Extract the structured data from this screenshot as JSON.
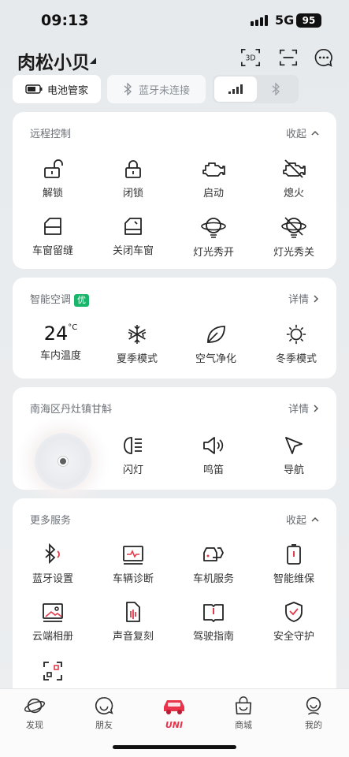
{
  "status": {
    "time": "09:13",
    "network": "5G",
    "battery": "95"
  },
  "header": {
    "car_name": "肉松小贝",
    "view_3d": "3D"
  },
  "chips": {
    "battery_manager": "电池管家",
    "bluetooth_status": "蓝牙未连接"
  },
  "remote_control": {
    "title": "远程控制",
    "toggle": "收起",
    "items": [
      {
        "label": "解锁",
        "icon": "unlock-icon"
      },
      {
        "label": "闭锁",
        "icon": "lock-icon"
      },
      {
        "label": "启动",
        "icon": "engine-start-icon"
      },
      {
        "label": "熄火",
        "icon": "engine-off-icon"
      },
      {
        "label": "车窗留缝",
        "icon": "window-vent-icon"
      },
      {
        "label": "关闭车窗",
        "icon": "window-close-icon"
      },
      {
        "label": "灯光秀开",
        "icon": "lightshow-on-icon"
      },
      {
        "label": "灯光秀关",
        "icon": "lightshow-off-icon"
      }
    ]
  },
  "climate": {
    "title": "智能空调",
    "badge": "优",
    "details": "详情",
    "temperature": "24",
    "temperature_unit": "°C",
    "items": [
      {
        "label": "车内温度"
      },
      {
        "label": "夏季模式",
        "icon": "snowflake-icon"
      },
      {
        "label": "空气净化",
        "icon": "leaf-icon"
      },
      {
        "label": "冬季模式",
        "icon": "sun-icon"
      }
    ]
  },
  "location": {
    "title": "南海区丹灶镇甘斛",
    "details": "详情",
    "items": [
      {
        "label": "闪灯",
        "icon": "headlight-icon"
      },
      {
        "label": "鸣笛",
        "icon": "horn-icon"
      },
      {
        "label": "导航",
        "icon": "navigation-icon"
      }
    ]
  },
  "more_services": {
    "title": "更多服务",
    "toggle": "收起",
    "items": [
      {
        "label": "蓝牙设置",
        "icon": "bluetooth-settings-icon"
      },
      {
        "label": "车辆诊断",
        "icon": "diagnosis-icon"
      },
      {
        "label": "车机服务",
        "icon": "car-service-icon"
      },
      {
        "label": "智能维保",
        "icon": "maintenance-icon"
      },
      {
        "label": "云端相册",
        "icon": "album-icon"
      },
      {
        "label": "声音复刻",
        "icon": "voice-clone-icon"
      },
      {
        "label": "驾驶指南",
        "icon": "guide-book-icon"
      },
      {
        "label": "安全守护",
        "icon": "shield-icon"
      }
    ]
  },
  "tabbar": {
    "items": [
      {
        "label": "发现",
        "icon": "planet-icon"
      },
      {
        "label": "朋友",
        "icon": "smile-chat-icon"
      },
      {
        "label": "UNI",
        "icon": "uni-car-icon",
        "active": true
      },
      {
        "label": "商城",
        "icon": "shopping-bag-icon"
      },
      {
        "label": "我的",
        "icon": "profile-icon"
      }
    ]
  },
  "colors": {
    "accent": "#e8334a",
    "badge_green": "#19b56a",
    "alert_red": "#e23c4c"
  }
}
